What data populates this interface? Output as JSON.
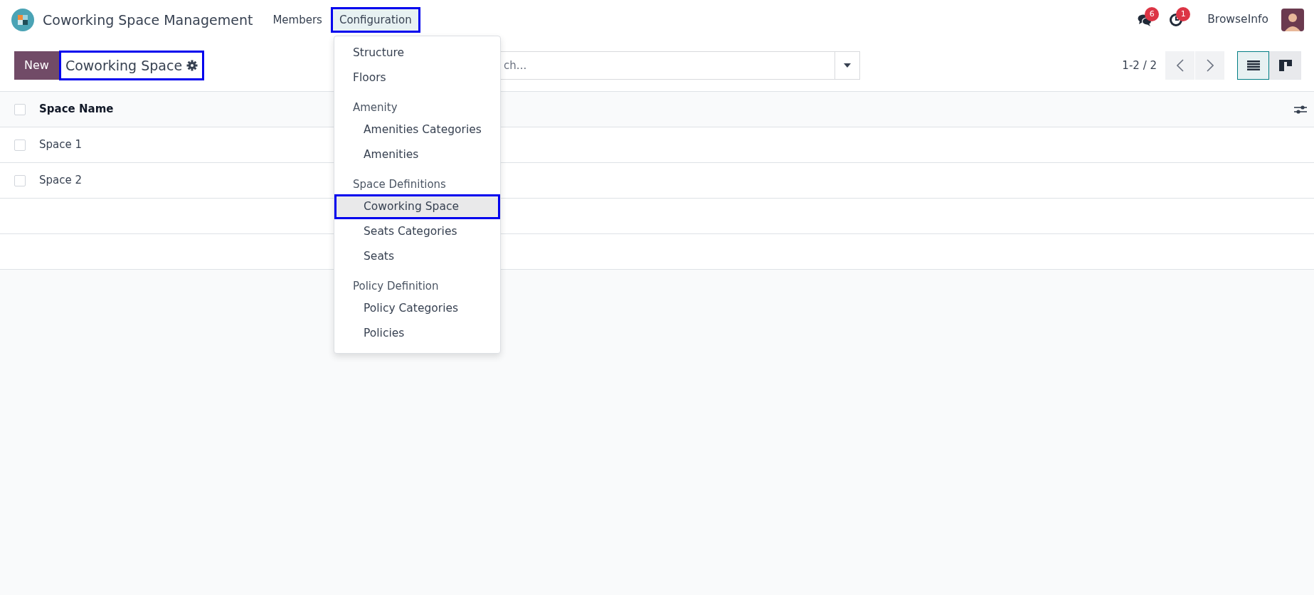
{
  "app": {
    "title": "Coworking Space Management"
  },
  "nav": [
    {
      "label": "Members",
      "open": false,
      "highlighted": false
    },
    {
      "label": "Configuration",
      "open": true,
      "highlighted": true
    }
  ],
  "systray": {
    "messages_count": "6",
    "activities_count": "1",
    "company": "BrowseInfo"
  },
  "control_panel": {
    "new_button": "New",
    "breadcrumb": "Coworking Space",
    "breadcrumb_highlighted": true,
    "search": {
      "placeholder": "ch..."
    },
    "pager": "1-2 / 2",
    "views": [
      {
        "kind": "list",
        "selected": true
      },
      {
        "kind": "kanban",
        "selected": false
      }
    ]
  },
  "table": {
    "columns": [
      "Space Name"
    ],
    "rows": [
      {
        "name": "Space 1",
        "checked": false
      },
      {
        "name": "Space 2",
        "checked": false
      }
    ],
    "all_checked": false
  },
  "menu": [
    {
      "kind": "item",
      "label": "Structure",
      "selected": false,
      "highlighted": false
    },
    {
      "kind": "item",
      "label": "Floors",
      "selected": false,
      "highlighted": false
    },
    {
      "kind": "section",
      "label": "Amenity",
      "children": [
        {
          "label": "Amenities Categories",
          "selected": false,
          "highlighted": false
        },
        {
          "label": "Amenities",
          "selected": false,
          "highlighted": false
        }
      ]
    },
    {
      "kind": "section",
      "label": "Space Definitions",
      "children": [
        {
          "label": "Coworking Space",
          "selected": true,
          "highlighted": true
        },
        {
          "label": "Seats Categories",
          "selected": false,
          "highlighted": false
        },
        {
          "label": "Seats",
          "selected": false,
          "highlighted": false
        }
      ]
    },
    {
      "kind": "section",
      "label": "Policy Definition",
      "children": [
        {
          "label": "Policy Categories",
          "selected": false,
          "highlighted": false
        },
        {
          "label": "Policies",
          "selected": false,
          "highlighted": false
        }
      ]
    }
  ]
}
